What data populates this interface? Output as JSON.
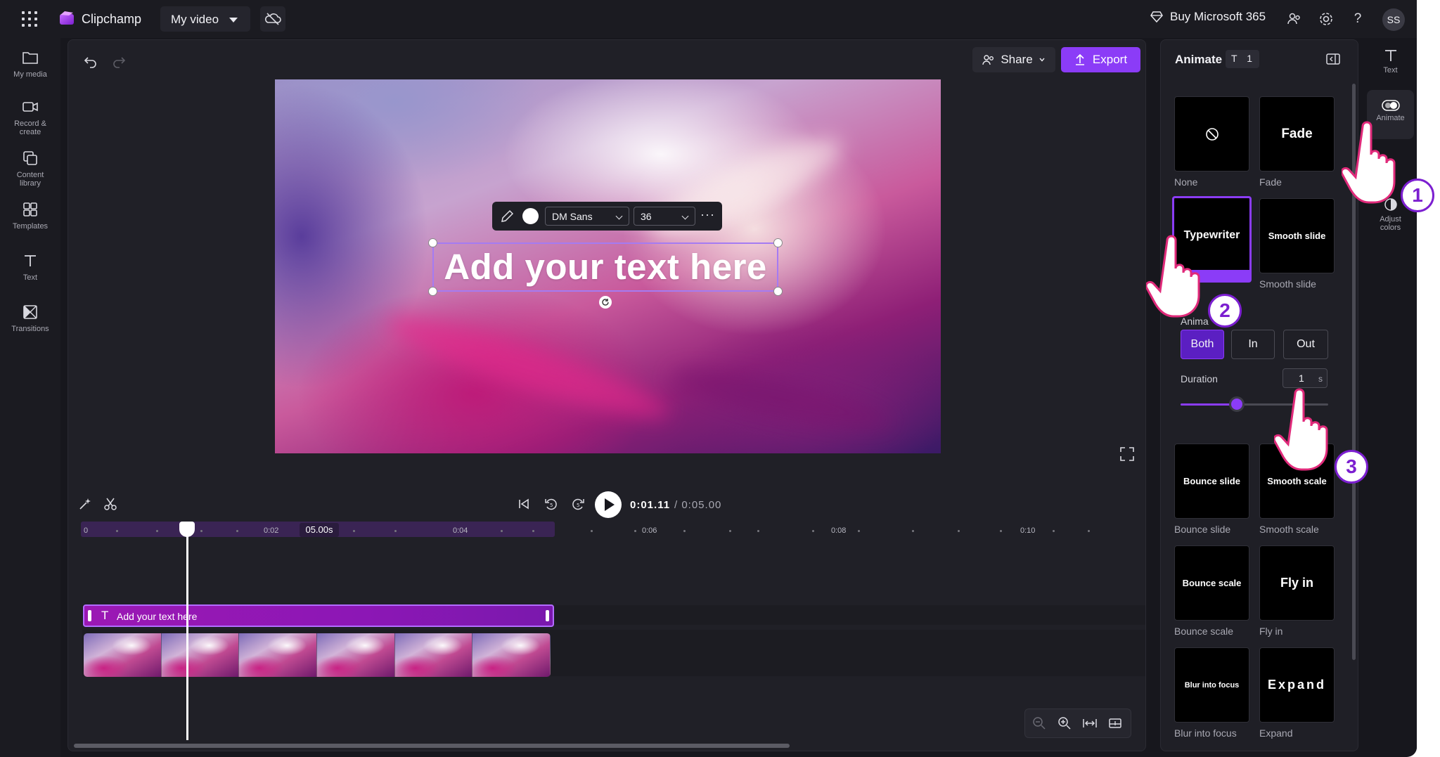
{
  "topbar": {
    "app_name": "Clipchamp",
    "video_name": "My video",
    "buy_label": "Buy Microsoft 365",
    "avatar_initials": "SS"
  },
  "left_rail": {
    "items": [
      {
        "label": "My media",
        "icon": "folder-icon"
      },
      {
        "label": "Record &\ncreate",
        "icon": "camera-icon"
      },
      {
        "label": "Content\nlibrary",
        "icon": "library-icon"
      },
      {
        "label": "Templates",
        "icon": "templates-icon"
      },
      {
        "label": "Text",
        "icon": "text-icon"
      },
      {
        "label": "Transitions",
        "icon": "transitions-icon"
      }
    ]
  },
  "editor": {
    "share_label": "Share",
    "export_label": "Export",
    "canvas_text": "Add your text here",
    "font_name": "DM Sans",
    "font_size": "36",
    "text_color": "#ffffff"
  },
  "timeline": {
    "current_time": "0:01.11",
    "total_time": "/ 0:05.00",
    "duration_badge": "05.00s",
    "ruler_labels": [
      "0",
      "0:02",
      "0:04",
      "0:06",
      "0:08",
      "0:10"
    ],
    "text_clip_label": "Add your text here"
  },
  "animate_panel": {
    "title": "Animate",
    "badge_count": "1",
    "cards": [
      {
        "card_text": "",
        "label": "None",
        "icon": "no-animation-icon"
      },
      {
        "card_text": "Fade",
        "label": "Fade"
      },
      {
        "card_text": "Typewriter",
        "label": "Typewriter",
        "selected": true
      },
      {
        "card_text": "Smooth slide",
        "label": "Smooth slide"
      },
      {
        "card_text": "Bounce slide",
        "label": "Bounce slide"
      },
      {
        "card_text": "Smooth scale",
        "label": "Smooth scale"
      },
      {
        "card_text": "Bounce scale",
        "label": "Bounce scale"
      },
      {
        "card_text": "Fly in",
        "label": "Fly in"
      },
      {
        "card_text": "Blur into focus",
        "label": "Blur into focus"
      },
      {
        "card_text": "Expand",
        "label": "Expand"
      }
    ],
    "direction_label": "Anima",
    "directions": [
      "Both",
      "In",
      "Out"
    ],
    "active_direction": "Both",
    "duration_label": "Duration",
    "duration_value": "1",
    "duration_unit": "s",
    "duration_slider_fraction": 0.38
  },
  "right_rail": {
    "items": [
      {
        "label": "Text",
        "icon": "text-icon"
      },
      {
        "label": "Animate",
        "icon": "animate-toggle-icon",
        "active": true
      },
      {
        "label": "Adjust\ncolors",
        "icon": "adjust-colors-icon"
      }
    ]
  },
  "overlay": {
    "steps": [
      "1",
      "2",
      "3"
    ]
  },
  "colors": {
    "accent": "#8b3cf7",
    "background": "#17171d",
    "clip_purple": "#9b18b4"
  }
}
